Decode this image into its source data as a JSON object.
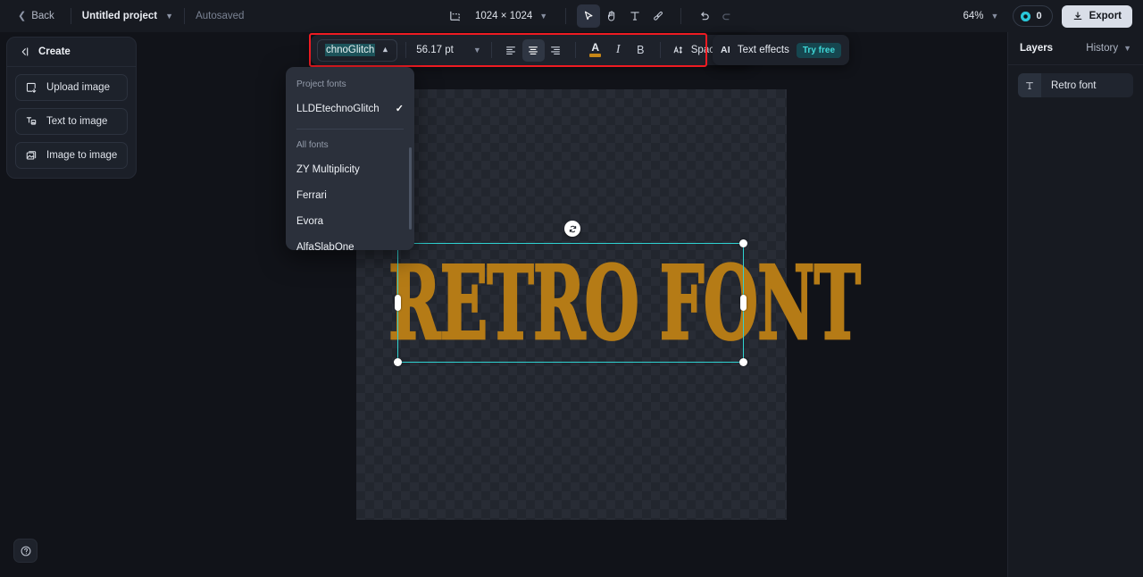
{
  "topbar": {
    "back_label": "Back",
    "project_name": "Untitled project",
    "autosaved_label": "Autosaved",
    "canvas_size": "1024 × 1024",
    "zoom_level": "64%",
    "credits_count": "0",
    "export_label": "Export",
    "tools": [
      {
        "name": "crop-icon",
        "label": "Crop"
      },
      {
        "name": "select-tool",
        "label": "Select",
        "active": true
      },
      {
        "name": "hand-tool",
        "label": "Hand"
      },
      {
        "name": "text-tool",
        "label": "Text"
      },
      {
        "name": "brush-tool",
        "label": "Brush"
      },
      {
        "name": "undo-button",
        "label": "Undo"
      },
      {
        "name": "redo-button",
        "label": "Redo"
      }
    ]
  },
  "left_panel": {
    "title": "Create",
    "items": [
      {
        "label": "Upload image",
        "icon": "upload-image-icon"
      },
      {
        "label": "Text to image",
        "icon": "text-to-image-icon"
      },
      {
        "label": "Image to image",
        "icon": "image-to-image-icon"
      }
    ]
  },
  "format_toolbar": {
    "font_name": "LLDEtechnoGlitch",
    "font_name_visible": "chnoGlitch",
    "font_size": "56.17 pt",
    "align": {
      "left_label": "Align left",
      "center_label": "Align center",
      "right_label": "Align right",
      "active": "center"
    },
    "text_color": "#c68617",
    "italic_label": "I",
    "bold_label": "B",
    "spacing_label": "Spacing",
    "ai_label": "AI",
    "text_effects_label": "Text effects",
    "try_free_label": "Try free"
  },
  "font_dropdown": {
    "project_fonts_label": "Project fonts",
    "all_fonts_label": "All fonts",
    "project_fonts": [
      {
        "name": "LLDEtechnoGlitch",
        "selected": true
      }
    ],
    "all_fonts": [
      {
        "name": "ZY Multiplicity",
        "selected": false
      },
      {
        "name": "Ferrari",
        "selected": false
      },
      {
        "name": "Evora",
        "selected": false
      },
      {
        "name": "AlfaSlabOne",
        "selected": false
      }
    ],
    "check_glyph": "✓"
  },
  "right_panel": {
    "layers_title": "Layers",
    "history_label": "History",
    "layers": [
      {
        "name": "Retro font",
        "type": "text"
      }
    ]
  },
  "canvas": {
    "text_content": "RETRO FONT",
    "text_color": "#b57b16",
    "selection_color": "#2fd2d2"
  },
  "help": {
    "glyph": "?"
  }
}
